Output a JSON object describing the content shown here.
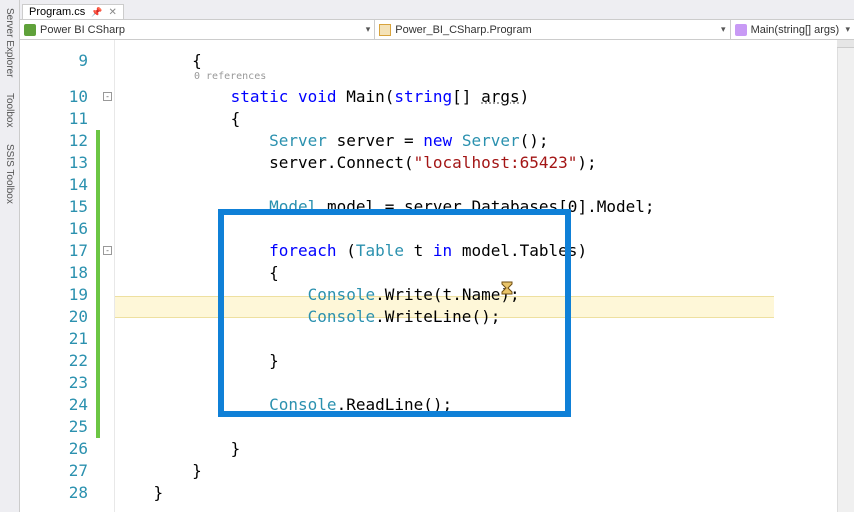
{
  "rail": {
    "server_explorer": "Server Explorer",
    "toolbox": "Toolbox",
    "ssis_toolbox": "SSIS Toolbox"
  },
  "fileTab": {
    "name": "Program.cs"
  },
  "nav": {
    "project": "Power BI CSharp",
    "namespace": "Power_BI_CSharp.Program",
    "member": "Main(string[] args)"
  },
  "codelens": {
    "references": "0 references"
  },
  "lines": {
    "start": 9,
    "end": 28
  },
  "code": {
    "l9": "         {",
    "l10_sig": {
      "kw_static": "static",
      "kw_void": "void",
      "name": "Main",
      "kw_string": "string",
      "param": "args"
    },
    "l11": "             {",
    "l12": {
      "type": "Server",
      "var": "server",
      "kw_new": "new",
      "ctor": "Server"
    },
    "l13": {
      "obj": "server",
      "method": "Connect",
      "arg": "\"localhost:65423\""
    },
    "l14": "",
    "l15": {
      "type": "Model",
      "var": "model",
      "expr1": "server",
      "expr2": "Databases",
      "idx": "0",
      "expr3": "Model"
    },
    "l16": "",
    "l17": {
      "kw_foreach": "foreach",
      "type": "Table",
      "var": "t",
      "kw_in": "in",
      "coll1": "model",
      "coll2": "Tables"
    },
    "l18": "                 {",
    "l19": {
      "cls": "Console",
      "method": "Write",
      "arg1": "t",
      "arg2": "Name"
    },
    "l20": {
      "cls": "Console",
      "method": "WriteLine"
    },
    "l21": "",
    "l22": "                 }",
    "l23": "",
    "l24": {
      "cls": "Console",
      "method": "ReadLine"
    },
    "l25": "",
    "l26": "             }",
    "l27": "         }",
    "l28": "     }"
  }
}
